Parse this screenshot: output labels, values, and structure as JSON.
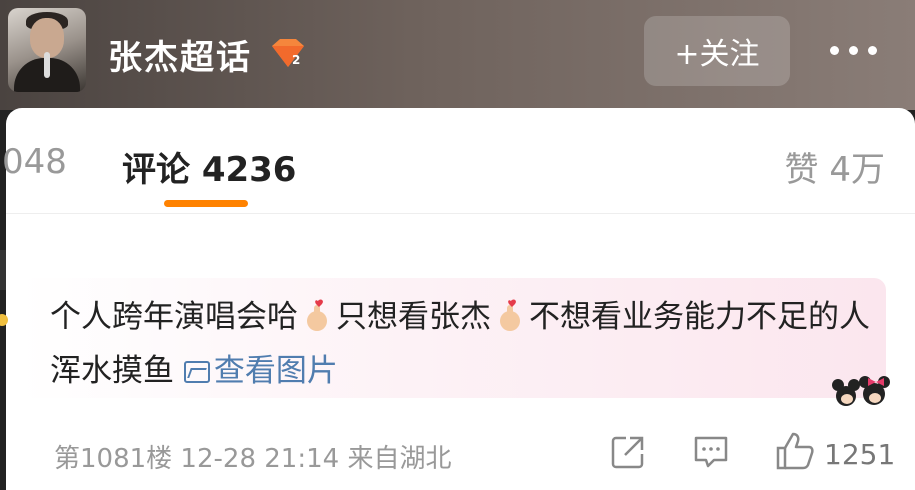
{
  "header": {
    "title": "张杰超话",
    "follow_label": "+关注",
    "badge_icon": "super-topic-level-badge",
    "more_icon": "more-dots-icon"
  },
  "tabs": {
    "repost_partial": "048",
    "comment_label": "评论 4236",
    "likes_label": "赞 4万",
    "accent_color": "#ff8200"
  },
  "comment": {
    "text_part1": "个人跨年演唱会哈",
    "text_part2": "只想看张杰",
    "text_part3": "不想看业务能力不足的人浑水摸鱼",
    "view_picture": "查看图片",
    "meta": "第1081楼 12-28 21:14 来自湖北",
    "like_count": "1251",
    "link_color": "#507daf"
  }
}
